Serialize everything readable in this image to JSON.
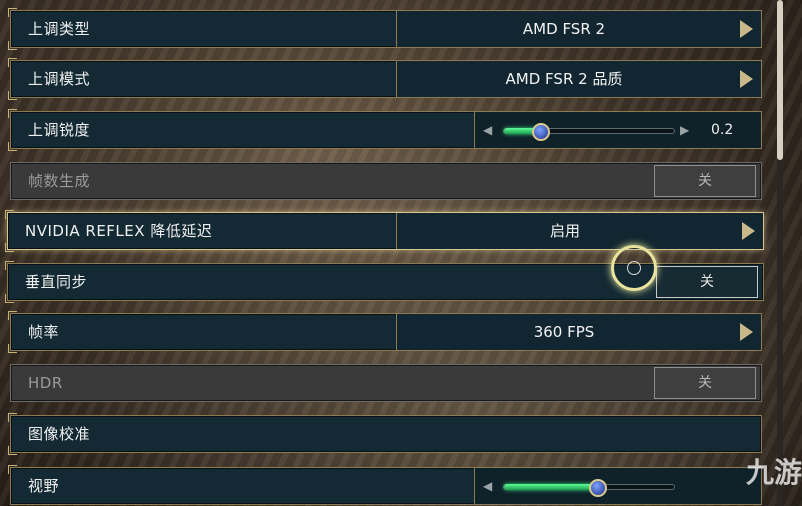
{
  "settings": [
    {
      "label": "上调类型",
      "type": "selector",
      "value": "AMD FSR 2"
    },
    {
      "label": "上调模式",
      "type": "selector",
      "value": "AMD FSR 2 品质"
    },
    {
      "label": "上调锐度",
      "type": "slider",
      "value": "0.2",
      "fraction": 0.22
    },
    {
      "label": "帧数生成",
      "type": "toggle",
      "value": "关",
      "disabled": true
    },
    {
      "label": "NVIDIA REFLEX 降低延迟",
      "type": "selector",
      "value": "启用",
      "highlighted": true
    },
    {
      "label": "垂直同步",
      "type": "toggle",
      "value": "关"
    },
    {
      "label": "帧率",
      "type": "selector",
      "value": "360 FPS"
    },
    {
      "label": "HDR",
      "type": "toggle",
      "value": "关",
      "disabled": true
    },
    {
      "label": "图像校准",
      "type": "button"
    },
    {
      "label": "视野",
      "type": "slider",
      "fraction": 0.55
    }
  ],
  "slider_arrows": {
    "left": "◀",
    "right": "▶"
  },
  "watermark": "九游",
  "colors": {
    "panel": "#132a34",
    "frame": "#8c7a52",
    "highlight": "#d8c68f",
    "slider_fill": "#3bd472",
    "knob": "#2a45b0"
  }
}
